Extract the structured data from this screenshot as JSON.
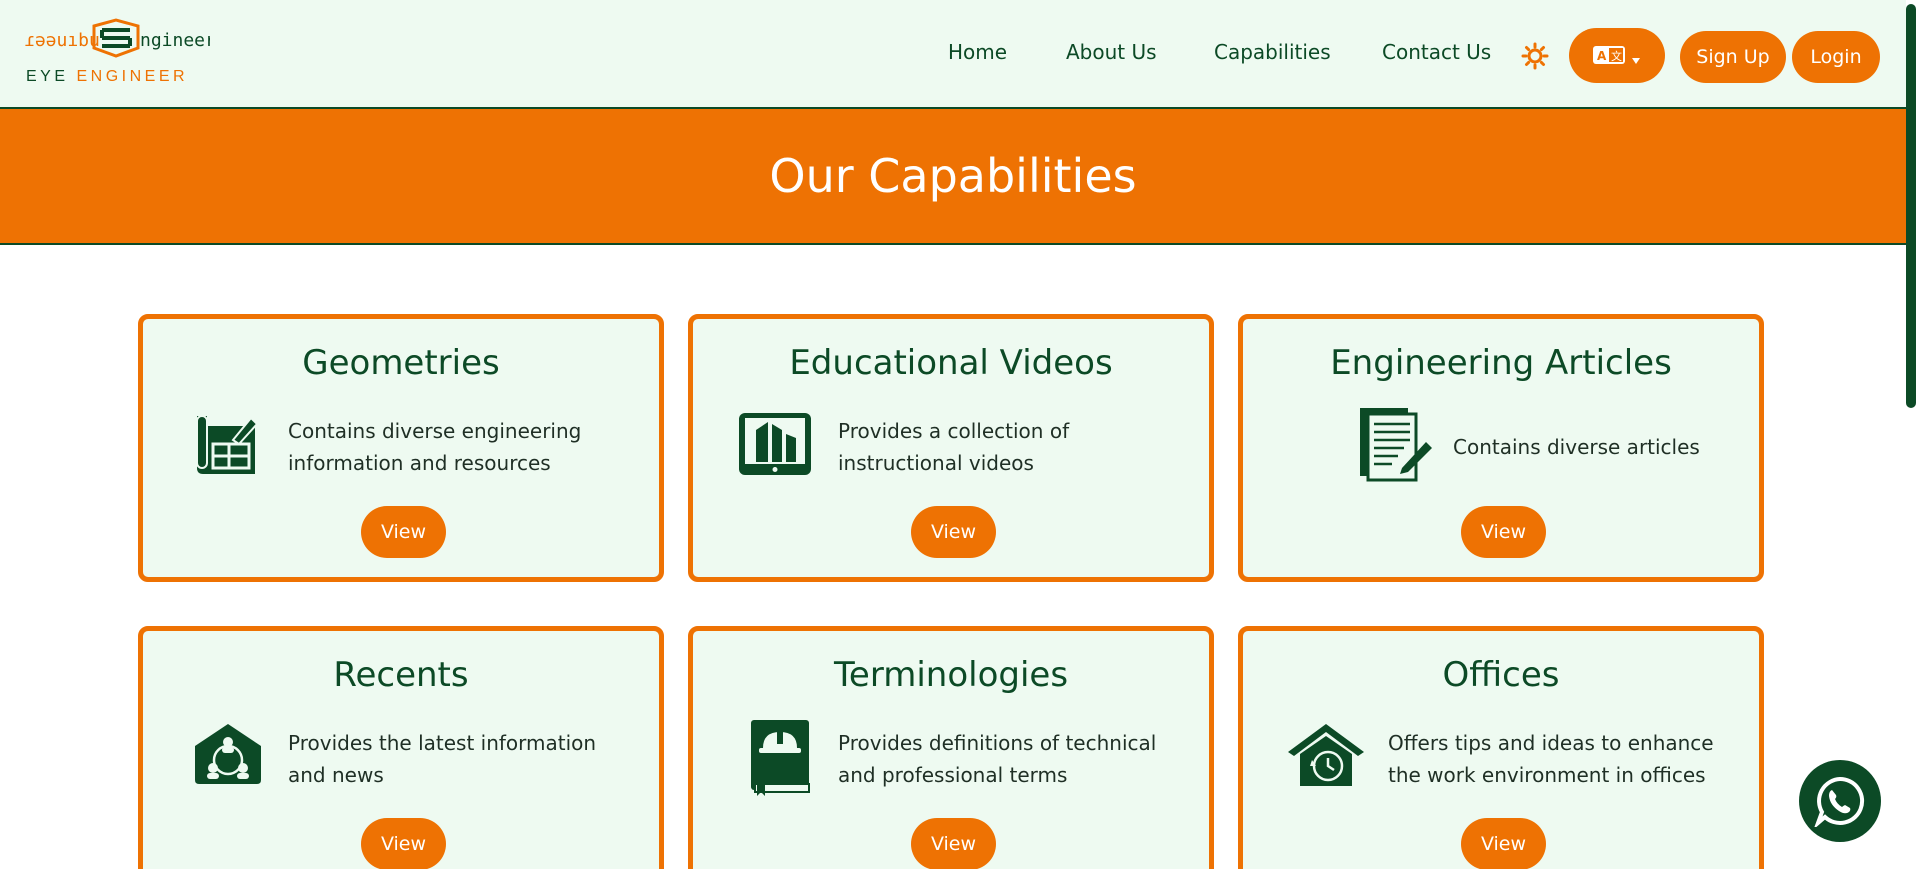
{
  "brand": {
    "logo_word": "EYE ENGINEER",
    "logo_word_part1": "EYE",
    "logo_word_part2": "ENGINEER",
    "primary_color": "#ee7203",
    "dark_color": "#0c4a26",
    "light_bg": "#eefaf1"
  },
  "nav": {
    "items": [
      "Home",
      "About Us",
      "Capabilities",
      "Contact Us"
    ],
    "theme_icon": "sun-icon",
    "language_icon": "translate-icon",
    "signup_label": "Sign Up",
    "login_label": "Login"
  },
  "banner": {
    "title": "Our Capabilities"
  },
  "cards": [
    {
      "title": "Geometries",
      "description": "Contains diverse engineering information and resources",
      "button": "View",
      "icon": "blueprint-icon"
    },
    {
      "title": "Educational Videos",
      "description": "Provides a collection of instructional videos",
      "button": "View",
      "icon": "tablet-video-icon"
    },
    {
      "title": "Engineering Articles",
      "description": "Contains diverse articles",
      "button": "View",
      "icon": "document-pen-icon"
    },
    {
      "title": "Recents",
      "description": "Provides the latest information and news",
      "button": "View",
      "icon": "house-people-icon"
    },
    {
      "title": "Terminologies",
      "description": "Provides definitions of technical and professional terms",
      "button": "View",
      "icon": "helmet-book-icon"
    },
    {
      "title": "Offices",
      "description": "Offers tips and ideas to enhance the work environment in offices",
      "button": "View",
      "icon": "house-clock-icon"
    }
  ],
  "floating": {
    "icon": "whatsapp-icon"
  }
}
